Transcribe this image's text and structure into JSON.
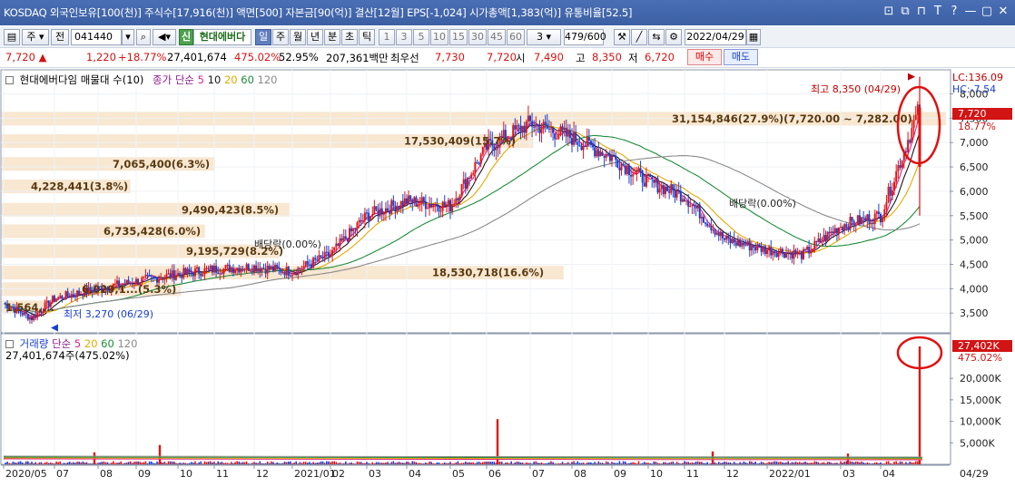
{
  "titlebar": {
    "text": "KOSDAQ 외국인보유[100(천)] 주식수[17,916(천)] 액면[500] 자본금[90(억)] 결산[12월] EPS[-1,024] 시가총액[1,383(억)] 유통비율[52.5]",
    "controls": [
      "⊡",
      "⧉",
      "⊓",
      "T",
      "?",
      "—",
      "▢",
      "✕"
    ]
  },
  "toolbar": {
    "market_type": "주",
    "prev_label": "전",
    "code": "041440",
    "badge": "신",
    "stock_name": "현대에버다",
    "periods": [
      "일",
      "주",
      "월",
      "년",
      "분",
      "초",
      "틱"
    ],
    "selected_period": "일",
    "intervals": [
      "1",
      "3",
      "5",
      "10",
      "15",
      "30",
      "45",
      "60"
    ],
    "interval_value": "3",
    "count": "479",
    "total": "/600",
    "date": "2022/04/29"
  },
  "quote": {
    "price": "7,720",
    "change": "1,220",
    "change_pct": "+18.77%",
    "volume": "27,401,674",
    "vol_ratio": "475.02%",
    "turnover": "52.95%",
    "amount": "207,361백만",
    "best_ask_label": "최우선",
    "best_ask": "7,730",
    "best_bid": "7,720",
    "open_label": "시",
    "open": "7,490",
    "high_label": "고",
    "high": "8,350",
    "low_label": "저",
    "low": "6,720",
    "buy_label": "매수",
    "sell_label": "매도"
  },
  "price_panel": {
    "legend_name": "현대에버다임 매물대 수(10)",
    "ma_label": "종가 단순",
    "ma_periods": [
      "5",
      "10",
      "20",
      "60",
      "120"
    ],
    "ma_colors": [
      "#e3208f",
      "#1a1a1a",
      "#e6a800",
      "#1e8c3a",
      "#8a8a8a"
    ],
    "lc_label": "LC:136.09",
    "hc_label": "HC:-7.54",
    "current_price_tag": "7,720",
    "change_pct_tag": "18.77%",
    "max_label": "최고 8,350 (04/29)",
    "min_label": "최저 3,270 (06/29)",
    "dividend_labels": [
      "배당락(0.00%)",
      "배당락(0.00%)"
    ],
    "y_ticks": [
      "8,000",
      "7,500",
      "7,000",
      "6,500",
      "6,000",
      "5,500",
      "5,000",
      "4,500",
      "4,000",
      "3,500"
    ]
  },
  "volume_profile": [
    {
      "label": "31,154,846(27.9%)(7,720.00 ~ 7,282.00)",
      "pct": 27.9
    },
    {
      "label": "17,530,409(15.7%)",
      "pct": 15.7
    },
    {
      "label": "7,065,400(6.3%)",
      "pct": 6.3
    },
    {
      "label": "4,228,441(3.8%)",
      "pct": 3.8
    },
    {
      "label": "9,490,423(8.5%)",
      "pct": 8.5
    },
    {
      "label": "6,735,428(6.0%)",
      "pct": 6.0
    },
    {
      "label": "9,195,729(8.2%)",
      "pct": 8.2
    },
    {
      "label": "18,530,718(16.6%)",
      "pct": 16.6
    },
    {
      "label": "6,029,1...(5.3%)",
      "pct": 5.3
    },
    {
      "label": "1,564,...",
      "pct": 1.4
    }
  ],
  "volume_panel": {
    "legend_name": "거래량",
    "ma_label": "단순",
    "ma_periods": [
      "5",
      "20",
      "60",
      "120"
    ],
    "ma_colors": [
      "#e3208f",
      "#e6a800",
      "#1e8c3a",
      "#8a8a8a"
    ],
    "info": "27,401,674주(475.02%)",
    "current_tag": "27,402K",
    "pct_tag": "475.02%",
    "y_ticks": [
      "20,000K",
      "15,000K",
      "10,000K",
      "5,000K"
    ]
  },
  "x_axis": {
    "labels": [
      "2020/05",
      "07",
      "08",
      "09",
      "10",
      "11",
      "12",
      "2021/01",
      "02",
      "03",
      "04",
      "05",
      "06",
      "07",
      "08",
      "09",
      "10",
      "11",
      "12",
      "2022/01",
      "03",
      "04"
    ],
    "right_label": "04/29"
  },
  "chart_data": {
    "type": "candlestick",
    "y_unit": "KRW",
    "ylim": [
      3270,
      8350
    ],
    "close_points": [
      [
        "2020/05",
        3700
      ],
      [
        "2020/06",
        3400
      ],
      [
        "2020/07",
        3800
      ],
      [
        "2020/08",
        4000
      ],
      [
        "2020/09",
        4150
      ],
      [
        "2020/10",
        4300
      ],
      [
        "2020/11",
        4400
      ],
      [
        "2020/12",
        4450
      ],
      [
        "2021/01",
        4350
      ],
      [
        "2021/02",
        4700
      ],
      [
        "2021/03",
        5500
      ],
      [
        "2021/04",
        5800
      ],
      [
        "2021/05",
        5700
      ],
      [
        "2021/06",
        6900
      ],
      [
        "2021/07",
        7400
      ],
      [
        "2021/08",
        7100
      ],
      [
        "2021/09",
        6700
      ],
      [
        "2021/10",
        6200
      ],
      [
        "2021/11",
        5900
      ],
      [
        "2021/12",
        5000
      ],
      [
        "2022/01",
        4800
      ],
      [
        "2022/02",
        4700
      ],
      [
        "2022/03",
        5300
      ],
      [
        "2022/04",
        5500
      ],
      [
        "2022/04/29",
        7720
      ]
    ],
    "volume_points_k": [
      [
        "2020/08",
        2800
      ],
      [
        "2020/10",
        4500
      ],
      [
        "2021/06",
        10500
      ],
      [
        "2021/11",
        3000
      ],
      [
        "2022/03",
        2500
      ],
      [
        "2022/04/29",
        27402
      ]
    ]
  }
}
